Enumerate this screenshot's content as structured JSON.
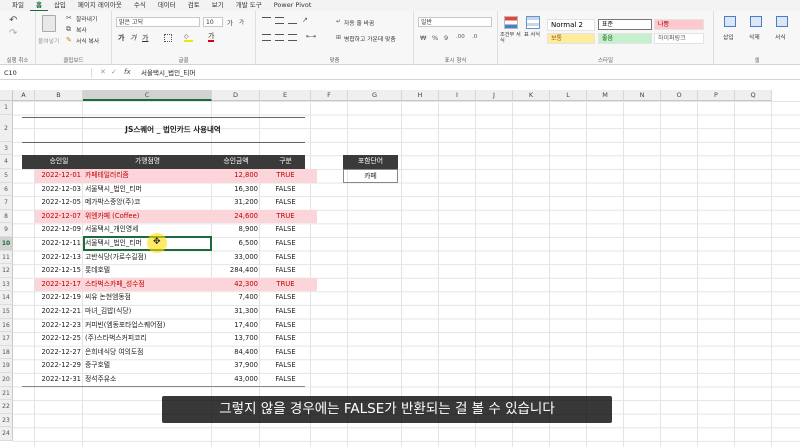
{
  "menu": {
    "tabs": [
      "파일",
      "홈",
      "삽입",
      "페이지 레이아웃",
      "수식",
      "데이터",
      "검토",
      "보기",
      "개발 도구",
      "Power Pivot"
    ],
    "active_index": 1
  },
  "ribbon": {
    "undo_label": "실행 취소",
    "clipboard_label": "클립보드",
    "paste_label": "붙여넣기",
    "cut_label": "잘라내기",
    "copy_label": "복사",
    "format_painter_label": "서식 복사",
    "font_label": "글꼴",
    "font_name": "맑은 고딕",
    "font_size": "10",
    "alignment_label": "맞춤",
    "wrap_text_label": "자동 줄 바꿈",
    "merge_center_label": "병합하고 가운데 맞춤",
    "number_label": "표시 형식",
    "number_format": "일반",
    "styles_label": "스타일",
    "conditional_format_label": "조건부 서식",
    "format_table_label": "표 서식",
    "styles": {
      "normal2": "Normal 2",
      "normal": "표준",
      "bad": "나쁨",
      "neutral": "보통",
      "good": "좋음",
      "hyperlink": "하이퍼링크"
    },
    "cells_label": "셀",
    "insert_label": "삽입",
    "delete_label": "삭제",
    "format_label": "서식"
  },
  "formula_bar": {
    "name_box": "C10",
    "fx": "fx",
    "value": "서울택시_법인_티머"
  },
  "columns": [
    "A",
    "B",
    "C",
    "D",
    "E",
    "F",
    "G",
    "H",
    "I",
    "J",
    "K",
    "L",
    "M",
    "N",
    "O",
    "P",
    "Q"
  ],
  "selected_column": "C",
  "rows": [
    "1",
    "2",
    "3",
    "4",
    "5",
    "6",
    "7",
    "8",
    "9",
    "10",
    "11",
    "12",
    "13",
    "14",
    "15",
    "16",
    "17",
    "18",
    "19",
    "20",
    "21",
    "22",
    "23",
    "24"
  ],
  "selected_row": "10",
  "sheet": {
    "title": "JS스퀘어 _ 법인카드 사용내역",
    "headers": [
      "승인일",
      "가맹점명",
      "승인금액",
      "구분"
    ],
    "records": [
      {
        "date": "2022-12-01",
        "merchant": "카페테일러리즘",
        "amount": "12,800",
        "flag": "TRUE",
        "highlight": true
      },
      {
        "date": "2022-12-03",
        "merchant": "서울택시_법인_티머",
        "amount": "16,300",
        "flag": "FALSE",
        "highlight": false
      },
      {
        "date": "2022-12-05",
        "merchant": "메가박스중앙(주)코",
        "amount": "31,200",
        "flag": "FALSE",
        "highlight": false
      },
      {
        "date": "2022-12-07",
        "merchant": "위엔카페 (Coffee)",
        "amount": "24,600",
        "flag": "TRUE",
        "highlight": true
      },
      {
        "date": "2022-12-09",
        "merchant": "서울택시_개인영세",
        "amount": "8,900",
        "flag": "FALSE",
        "highlight": false
      },
      {
        "date": "2022-12-11",
        "merchant": "서울택시_법인_티머",
        "amount": "6,500",
        "flag": "FALSE",
        "highlight": false
      },
      {
        "date": "2022-12-13",
        "merchant": "고반식당(가로수길점)",
        "amount": "33,000",
        "flag": "FALSE",
        "highlight": false
      },
      {
        "date": "2022-12-15",
        "merchant": "롯데호텔",
        "amount": "284,400",
        "flag": "FALSE",
        "highlight": false
      },
      {
        "date": "2022-12-17",
        "merchant": "스타벅스카페_성수점",
        "amount": "42,300",
        "flag": "TRUE",
        "highlight": true
      },
      {
        "date": "2022-12-19",
        "merchant": "씨유 논현엠동점",
        "amount": "7,400",
        "flag": "FALSE",
        "highlight": false
      },
      {
        "date": "2022-12-21",
        "merchant": "마녀_김밥(식당)",
        "amount": "31,300",
        "flag": "FALSE",
        "highlight": false
      },
      {
        "date": "2022-12-23",
        "merchant": "커피빈(엠동포타업스퀘어점)",
        "amount": "17,400",
        "flag": "FALSE",
        "highlight": false
      },
      {
        "date": "2022-12-25",
        "merchant": "(주)스타벅스커피코리",
        "amount": "13,700",
        "flag": "FALSE",
        "highlight": false
      },
      {
        "date": "2022-12-27",
        "merchant": "은희네식당 여의도점",
        "amount": "84,400",
        "flag": "FALSE",
        "highlight": false
      },
      {
        "date": "2022-12-29",
        "merchant": "중구호텔",
        "amount": "37,900",
        "flag": "FALSE",
        "highlight": false
      },
      {
        "date": "2022-12-31",
        "merchant": "정석주유소",
        "amount": "43,000",
        "flag": "FALSE",
        "highlight": false
      }
    ],
    "lookup_header": "포함단어",
    "lookup_value": "카페"
  },
  "subtitle": "그렇지 않을 경우에는 FALSE가 반환되는 걸 볼 수 있습니다",
  "colors": {
    "accent": "#1e6b3a",
    "header_bg": "#3a3a3a",
    "highlight": "#fbd5d9",
    "highlight_text": "#c00000"
  }
}
